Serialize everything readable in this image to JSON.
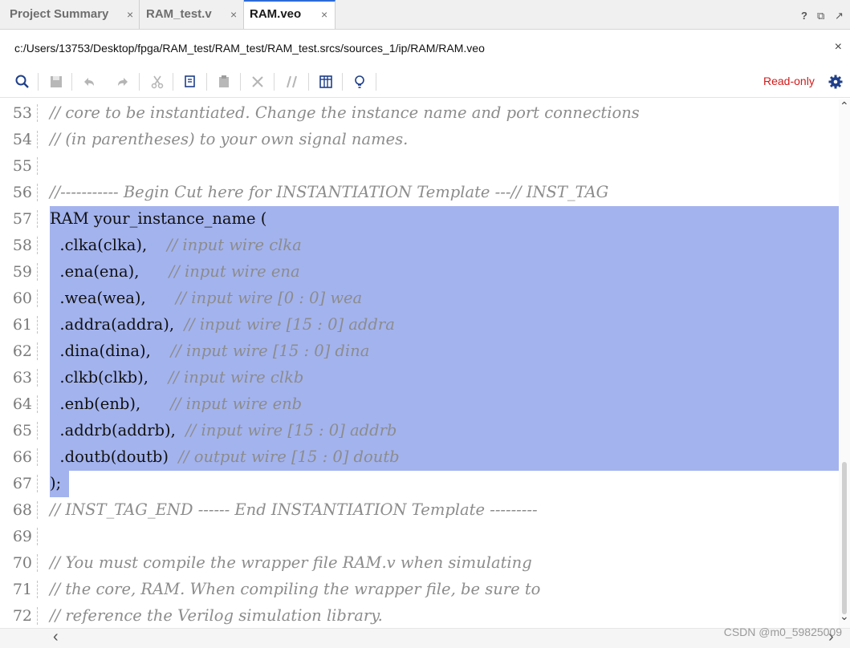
{
  "tabs": [
    {
      "label": "Project Summary",
      "close": "×",
      "active": false
    },
    {
      "label": "RAM_test.v",
      "close": "×",
      "active": false
    },
    {
      "label": "RAM.veo",
      "close": "×",
      "active": true
    }
  ],
  "window_controls": {
    "help": "?",
    "restore": "⧉",
    "float": "↗"
  },
  "file_path": "c:/Users/13753/Desktop/fpga/RAM_test/RAM_test/RAM_test.srcs/sources_1/ip/RAM/RAM.veo",
  "path_close": "×",
  "toolbar": {
    "icons": [
      "search-icon",
      "save-icon",
      "undo-icon",
      "redo-icon",
      "cut-icon",
      "copy-icon",
      "paste-icon",
      "delete-icon",
      "comment-icon",
      "columns-icon",
      "lightbulb-icon"
    ],
    "status": "Read-only",
    "settings_icon": "gear-icon"
  },
  "editor": {
    "lines": [
      {
        "num": "53",
        "code": "",
        "comment": "// core to be instantiated. Change the instance name and port connections"
      },
      {
        "num": "54",
        "code": "",
        "comment": "// (in parentheses) to your own signal names."
      },
      {
        "num": "55",
        "code": "",
        "comment": ""
      },
      {
        "num": "56",
        "code": "",
        "comment": "//----------- Begin Cut here for INSTANTIATION Template ---// INST_TAG"
      },
      {
        "num": "57",
        "code": "RAM your_instance_name (",
        "comment": ""
      },
      {
        "num": "58",
        "code": "  .clka(clka),    ",
        "comment": "// input wire clka"
      },
      {
        "num": "59",
        "code": "  .ena(ena),      ",
        "comment": "// input wire ena"
      },
      {
        "num": "60",
        "code": "  .wea(wea),      ",
        "comment": "// input wire [0 : 0] wea"
      },
      {
        "num": "61",
        "code": "  .addra(addra),  ",
        "comment": "// input wire [15 : 0] addra"
      },
      {
        "num": "62",
        "code": "  .dina(dina),    ",
        "comment": "// input wire [15 : 0] dina"
      },
      {
        "num": "63",
        "code": "  .clkb(clkb),    ",
        "comment": "// input wire clkb"
      },
      {
        "num": "64",
        "code": "  .enb(enb),      ",
        "comment": "// input wire enb"
      },
      {
        "num": "65",
        "code": "  .addrb(addrb),  ",
        "comment": "// input wire [15 : 0] addrb"
      },
      {
        "num": "66",
        "code": "  .doutb(doutb)  ",
        "comment": "// output wire [15 : 0] doutb"
      },
      {
        "num": "67",
        "code": ");",
        "comment": ""
      },
      {
        "num": "68",
        "code": "",
        "comment": "// INST_TAG_END ------ End INSTANTIATION Template ---------"
      },
      {
        "num": "69",
        "code": "",
        "comment": ""
      },
      {
        "num": "70",
        "code": "",
        "comment": "// You must compile the wrapper file RAM.v when simulating"
      },
      {
        "num": "71",
        "code": "",
        "comment": "// the core, RAM. When compiling the wrapper file, be sure to"
      },
      {
        "num": "72",
        "code": "",
        "comment": "// reference the Verilog simulation library."
      }
    ]
  },
  "scroll": {
    "up": "⌃",
    "down": "⌄",
    "left": "‹",
    "right": "›"
  },
  "watermark": "CSDN @m0_59825009",
  "colors": {
    "selection": "#a3b3ee",
    "readonly": "#d01b1b",
    "tab_accent": "#2c6bd6"
  }
}
